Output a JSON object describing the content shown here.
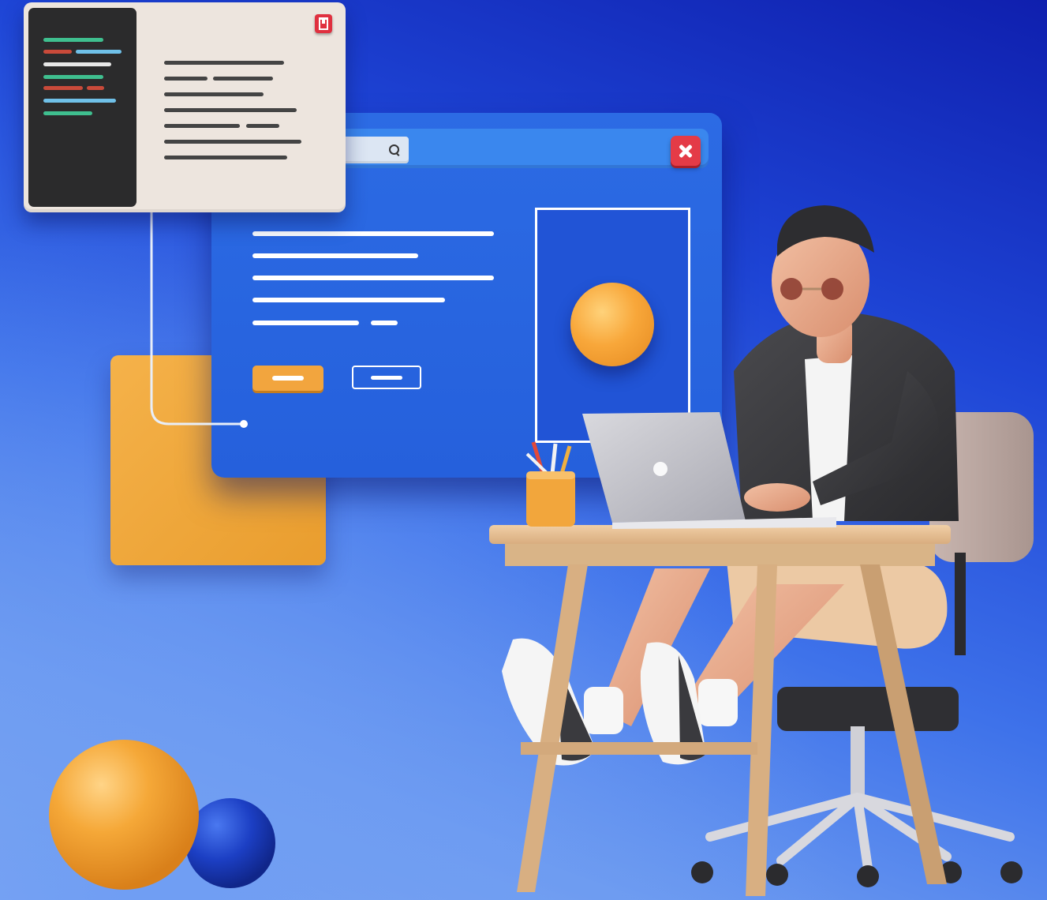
{
  "scene": {
    "background_colors": [
      "#0f1fae",
      "#3e72ea",
      "#86aef2"
    ],
    "accent_orange": "#f2a53e",
    "accent_red": "#e43b47"
  },
  "editor_window": {
    "save_icon": "save-icon",
    "code_line_colors": [
      "#3fbf8f",
      "#c94a3a",
      "#e8e8e8",
      "#6fc0e8"
    ]
  },
  "browser_window": {
    "search_icon": "search-icon",
    "close_icon": "close-icon",
    "preview_image": "orange-ball"
  },
  "illustration": {
    "subject": "person-at-laptop",
    "objects": [
      "laptop-icon",
      "pencil-cup",
      "desk",
      "office-chair",
      "orange-sphere",
      "blue-sphere"
    ]
  }
}
